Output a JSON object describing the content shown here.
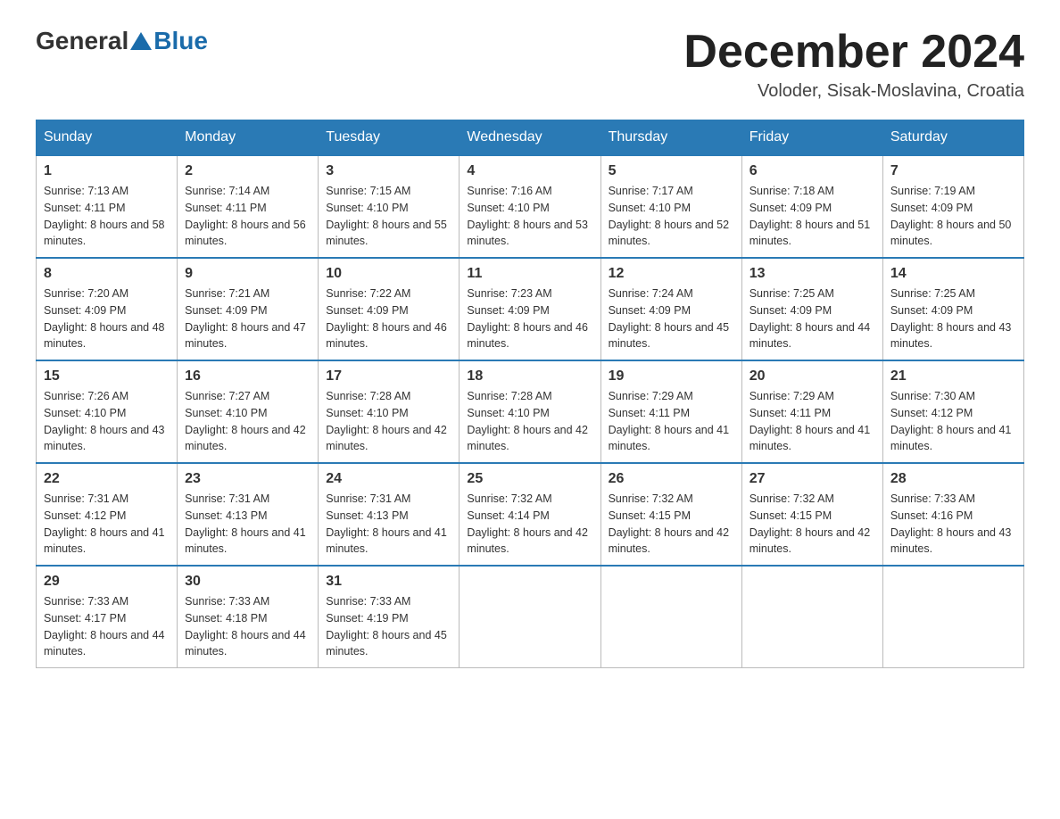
{
  "header": {
    "logo_general": "General",
    "logo_blue": "Blue",
    "title": "December 2024",
    "subtitle": "Voloder, Sisak-Moslavina, Croatia"
  },
  "days_of_week": [
    "Sunday",
    "Monday",
    "Tuesday",
    "Wednesday",
    "Thursday",
    "Friday",
    "Saturday"
  ],
  "weeks": [
    [
      {
        "day": "1",
        "sunrise": "7:13 AM",
        "sunset": "4:11 PM",
        "daylight": "8 hours and 58 minutes."
      },
      {
        "day": "2",
        "sunrise": "7:14 AM",
        "sunset": "4:11 PM",
        "daylight": "8 hours and 56 minutes."
      },
      {
        "day": "3",
        "sunrise": "7:15 AM",
        "sunset": "4:10 PM",
        "daylight": "8 hours and 55 minutes."
      },
      {
        "day": "4",
        "sunrise": "7:16 AM",
        "sunset": "4:10 PM",
        "daylight": "8 hours and 53 minutes."
      },
      {
        "day": "5",
        "sunrise": "7:17 AM",
        "sunset": "4:10 PM",
        "daylight": "8 hours and 52 minutes."
      },
      {
        "day": "6",
        "sunrise": "7:18 AM",
        "sunset": "4:09 PM",
        "daylight": "8 hours and 51 minutes."
      },
      {
        "day": "7",
        "sunrise": "7:19 AM",
        "sunset": "4:09 PM",
        "daylight": "8 hours and 50 minutes."
      }
    ],
    [
      {
        "day": "8",
        "sunrise": "7:20 AM",
        "sunset": "4:09 PM",
        "daylight": "8 hours and 48 minutes."
      },
      {
        "day": "9",
        "sunrise": "7:21 AM",
        "sunset": "4:09 PM",
        "daylight": "8 hours and 47 minutes."
      },
      {
        "day": "10",
        "sunrise": "7:22 AM",
        "sunset": "4:09 PM",
        "daylight": "8 hours and 46 minutes."
      },
      {
        "day": "11",
        "sunrise": "7:23 AM",
        "sunset": "4:09 PM",
        "daylight": "8 hours and 46 minutes."
      },
      {
        "day": "12",
        "sunrise": "7:24 AM",
        "sunset": "4:09 PM",
        "daylight": "8 hours and 45 minutes."
      },
      {
        "day": "13",
        "sunrise": "7:25 AM",
        "sunset": "4:09 PM",
        "daylight": "8 hours and 44 minutes."
      },
      {
        "day": "14",
        "sunrise": "7:25 AM",
        "sunset": "4:09 PM",
        "daylight": "8 hours and 43 minutes."
      }
    ],
    [
      {
        "day": "15",
        "sunrise": "7:26 AM",
        "sunset": "4:10 PM",
        "daylight": "8 hours and 43 minutes."
      },
      {
        "day": "16",
        "sunrise": "7:27 AM",
        "sunset": "4:10 PM",
        "daylight": "8 hours and 42 minutes."
      },
      {
        "day": "17",
        "sunrise": "7:28 AM",
        "sunset": "4:10 PM",
        "daylight": "8 hours and 42 minutes."
      },
      {
        "day": "18",
        "sunrise": "7:28 AM",
        "sunset": "4:10 PM",
        "daylight": "8 hours and 42 minutes."
      },
      {
        "day": "19",
        "sunrise": "7:29 AM",
        "sunset": "4:11 PM",
        "daylight": "8 hours and 41 minutes."
      },
      {
        "day": "20",
        "sunrise": "7:29 AM",
        "sunset": "4:11 PM",
        "daylight": "8 hours and 41 minutes."
      },
      {
        "day": "21",
        "sunrise": "7:30 AM",
        "sunset": "4:12 PM",
        "daylight": "8 hours and 41 minutes."
      }
    ],
    [
      {
        "day": "22",
        "sunrise": "7:31 AM",
        "sunset": "4:12 PM",
        "daylight": "8 hours and 41 minutes."
      },
      {
        "day": "23",
        "sunrise": "7:31 AM",
        "sunset": "4:13 PM",
        "daylight": "8 hours and 41 minutes."
      },
      {
        "day": "24",
        "sunrise": "7:31 AM",
        "sunset": "4:13 PM",
        "daylight": "8 hours and 41 minutes."
      },
      {
        "day": "25",
        "sunrise": "7:32 AM",
        "sunset": "4:14 PM",
        "daylight": "8 hours and 42 minutes."
      },
      {
        "day": "26",
        "sunrise": "7:32 AM",
        "sunset": "4:15 PM",
        "daylight": "8 hours and 42 minutes."
      },
      {
        "day": "27",
        "sunrise": "7:32 AM",
        "sunset": "4:15 PM",
        "daylight": "8 hours and 42 minutes."
      },
      {
        "day": "28",
        "sunrise": "7:33 AM",
        "sunset": "4:16 PM",
        "daylight": "8 hours and 43 minutes."
      }
    ],
    [
      {
        "day": "29",
        "sunrise": "7:33 AM",
        "sunset": "4:17 PM",
        "daylight": "8 hours and 44 minutes."
      },
      {
        "day": "30",
        "sunrise": "7:33 AM",
        "sunset": "4:18 PM",
        "daylight": "8 hours and 44 minutes."
      },
      {
        "day": "31",
        "sunrise": "7:33 AM",
        "sunset": "4:19 PM",
        "daylight": "8 hours and 45 minutes."
      },
      null,
      null,
      null,
      null
    ]
  ]
}
